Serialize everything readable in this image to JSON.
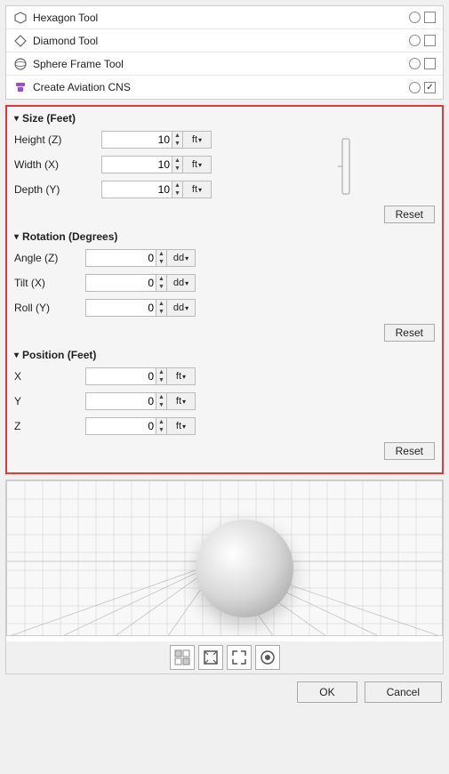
{
  "tools": [
    {
      "id": "hexagon",
      "label": "Hexagon Tool",
      "icon": "⬡",
      "radio": true,
      "checked": false
    },
    {
      "id": "diamond",
      "label": "Diamond Tool",
      "icon": "◇",
      "radio": true,
      "checked": false
    },
    {
      "id": "sphere-frame",
      "label": "Sphere Frame Tool",
      "icon": "⊙",
      "radio": true,
      "checked": false
    },
    {
      "id": "aviation-cns",
      "label": "Create Aviation CNS",
      "icon": "▼",
      "radio": true,
      "checked": true
    }
  ],
  "size_section": {
    "header": "Size (Feet)",
    "fields": [
      {
        "id": "height",
        "label": "Height (Z)",
        "value": "10",
        "unit": "ft"
      },
      {
        "id": "width",
        "label": "Width (X)",
        "value": "10",
        "unit": "ft"
      },
      {
        "id": "depth",
        "label": "Depth (Y)",
        "value": "10",
        "unit": "ft"
      }
    ],
    "reset_label": "Reset"
  },
  "rotation_section": {
    "header": "Rotation (Degrees)",
    "fields": [
      {
        "id": "angle",
        "label": "Angle (Z)",
        "value": "0",
        "unit": "dd"
      },
      {
        "id": "tilt",
        "label": "Tilt (X)",
        "value": "0",
        "unit": "dd"
      },
      {
        "id": "roll",
        "label": "Roll (Y)",
        "value": "0",
        "unit": "dd"
      }
    ],
    "reset_label": "Reset"
  },
  "position_section": {
    "header": "Position (Feet)",
    "fields": [
      {
        "id": "pos-x",
        "label": "X",
        "value": "0",
        "unit": "ft"
      },
      {
        "id": "pos-y",
        "label": "Y",
        "value": "0",
        "unit": "ft"
      },
      {
        "id": "pos-z",
        "label": "Z",
        "value": "0",
        "unit": "ft"
      }
    ],
    "reset_label": "Reset"
  },
  "footer": {
    "ok_label": "OK",
    "cancel_label": "Cancel"
  },
  "viewport_tools": [
    {
      "id": "grid-toggle",
      "icon": "⊞"
    },
    {
      "id": "fit-view",
      "icon": "⛶"
    },
    {
      "id": "expand",
      "icon": "⤢"
    },
    {
      "id": "sphere-view",
      "icon": "◉"
    }
  ]
}
